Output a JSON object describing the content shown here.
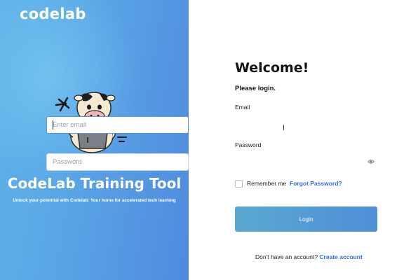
{
  "brand": {
    "logo_text": "codelab",
    "title": "CodeLab Training Tool",
    "subtitle": "Unlock your potential with Codelab: Your home for accelerated tech learning"
  },
  "form": {
    "heading": "Welcome!",
    "subheading": "Please login.",
    "email_label": "Email",
    "email_placeholder": "Enter email",
    "email_value": "",
    "password_label": "Password",
    "password_placeholder": "Password",
    "password_value": "",
    "remember_label": "Remember me",
    "remember_checked": false,
    "forgot_label": "Forgot Password?",
    "login_label": "Login",
    "signup_prompt": "Don't have an account?",
    "signup_link": "Create account"
  },
  "icons": {
    "password_toggle": "eye-icon",
    "mascot": "cow-mascot-with-laptop"
  },
  "colors": {
    "panel_gradient_start": "#5fb3e8",
    "panel_gradient_end": "#4f8ade",
    "accent_link": "#2f6fd6",
    "focus_border": "#5b97e0"
  }
}
